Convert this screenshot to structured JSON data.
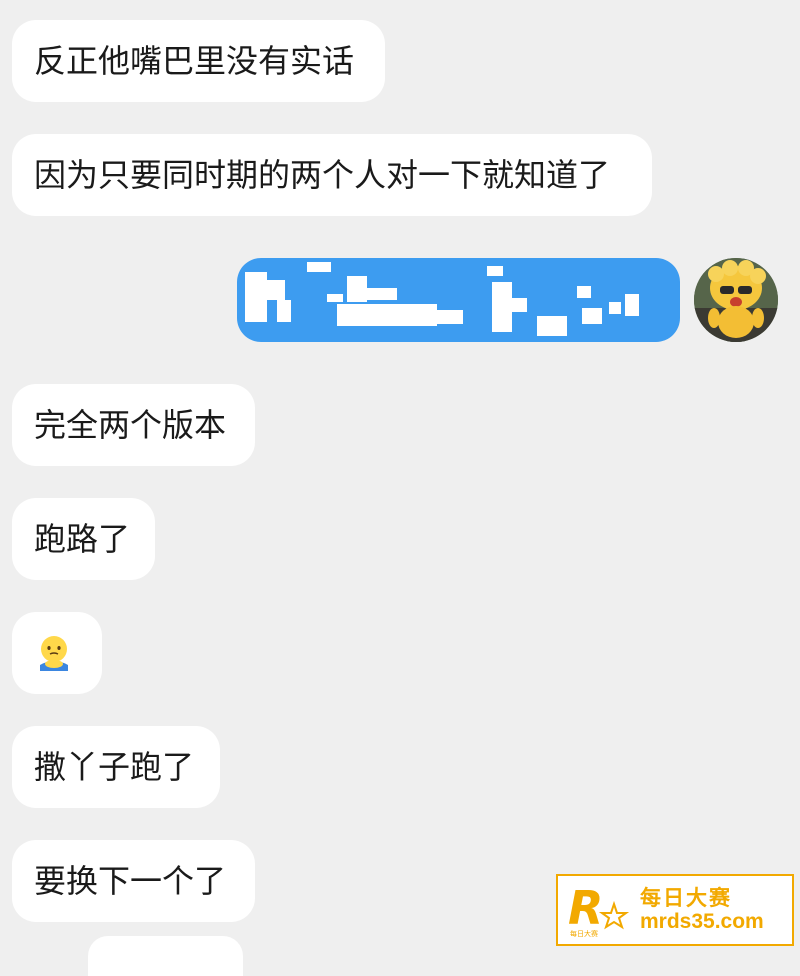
{
  "messages": {
    "m1": "反正他嘴巴里没有实话",
    "m2": "因为只要同时期的两个人对一下就知道了",
    "m4": "完全两个版本",
    "m5": "跑路了",
    "m7": "撒丫子跑了",
    "m8": "要换下一个了"
  },
  "sent_message": {
    "state": "redacted",
    "bubble_color": "#3d9cf0"
  },
  "emoji_message": {
    "icon": "salute-face-emoji"
  },
  "avatar": {
    "icon": "cartoon-character-avatar"
  },
  "watermark": {
    "line1": "每日大赛",
    "line2": "mrds35.com",
    "logo_letter": "R",
    "logo_small_text": "每日大赛",
    "accent_color": "#f2a900"
  }
}
